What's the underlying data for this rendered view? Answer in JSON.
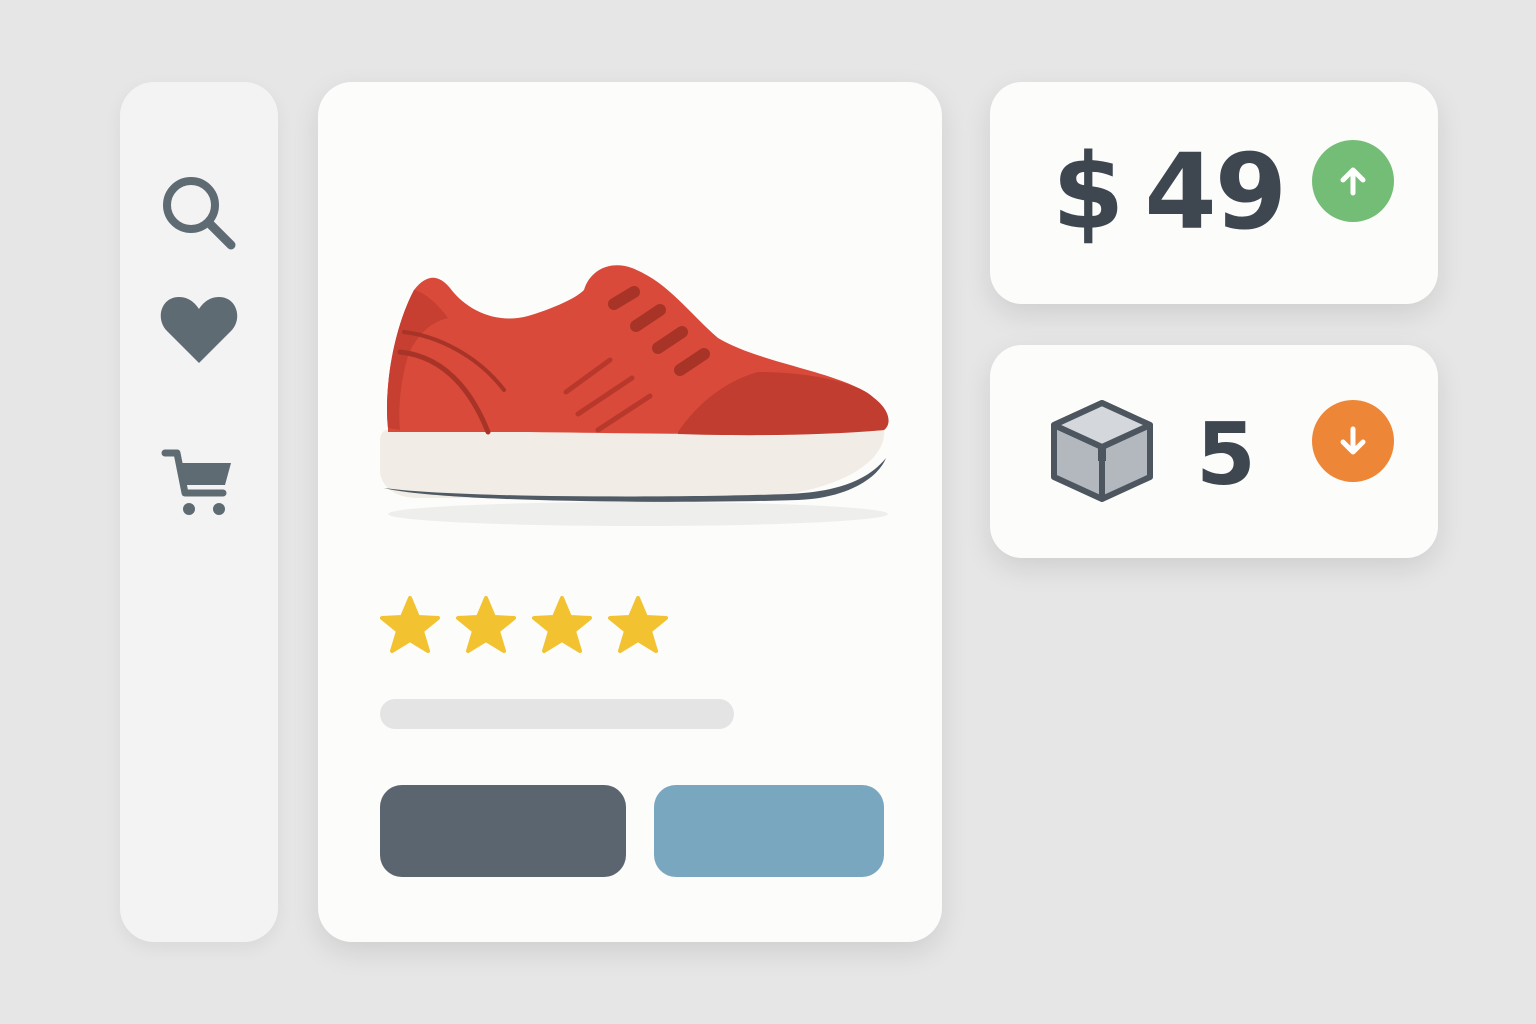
{
  "sidebar": {
    "items": [
      {
        "icon": "search-icon"
      },
      {
        "icon": "heart-icon"
      },
      {
        "icon": "cart-icon"
      }
    ]
  },
  "product": {
    "image": "sneaker-image",
    "rating": 4,
    "buttons": [
      {
        "style": "primary",
        "color": "#5b6570"
      },
      {
        "style": "secondary",
        "color": "#79a7bf"
      }
    ]
  },
  "price_card": {
    "currency": "$",
    "amount": "49",
    "trend": "up",
    "trend_color": "#74bd76"
  },
  "stock_card": {
    "icon": "box-icon",
    "count": "5",
    "trend": "down",
    "trend_color": "#ed8636"
  },
  "colors": {
    "background": "#e6e6e6",
    "card": "#fcfcfb",
    "text": "#3e474f",
    "icon": "#5f6b73",
    "star": "#f2c230",
    "shoe": "#d94a3a"
  }
}
